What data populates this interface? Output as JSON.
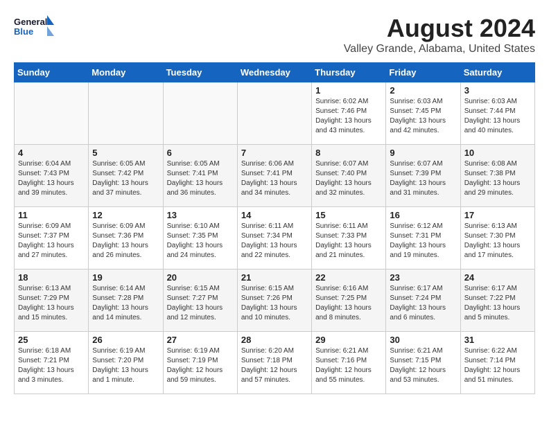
{
  "header": {
    "logo_line1": "General",
    "logo_line2": "Blue",
    "month_year": "August 2024",
    "location": "Valley Grande, Alabama, United States"
  },
  "weekdays": [
    "Sunday",
    "Monday",
    "Tuesday",
    "Wednesday",
    "Thursday",
    "Friday",
    "Saturday"
  ],
  "weeks": [
    [
      {
        "day": "",
        "info": ""
      },
      {
        "day": "",
        "info": ""
      },
      {
        "day": "",
        "info": ""
      },
      {
        "day": "",
        "info": ""
      },
      {
        "day": "1",
        "info": "Sunrise: 6:02 AM\nSunset: 7:46 PM\nDaylight: 13 hours\nand 43 minutes."
      },
      {
        "day": "2",
        "info": "Sunrise: 6:03 AM\nSunset: 7:45 PM\nDaylight: 13 hours\nand 42 minutes."
      },
      {
        "day": "3",
        "info": "Sunrise: 6:03 AM\nSunset: 7:44 PM\nDaylight: 13 hours\nand 40 minutes."
      }
    ],
    [
      {
        "day": "4",
        "info": "Sunrise: 6:04 AM\nSunset: 7:43 PM\nDaylight: 13 hours\nand 39 minutes."
      },
      {
        "day": "5",
        "info": "Sunrise: 6:05 AM\nSunset: 7:42 PM\nDaylight: 13 hours\nand 37 minutes."
      },
      {
        "day": "6",
        "info": "Sunrise: 6:05 AM\nSunset: 7:41 PM\nDaylight: 13 hours\nand 36 minutes."
      },
      {
        "day": "7",
        "info": "Sunrise: 6:06 AM\nSunset: 7:41 PM\nDaylight: 13 hours\nand 34 minutes."
      },
      {
        "day": "8",
        "info": "Sunrise: 6:07 AM\nSunset: 7:40 PM\nDaylight: 13 hours\nand 32 minutes."
      },
      {
        "day": "9",
        "info": "Sunrise: 6:07 AM\nSunset: 7:39 PM\nDaylight: 13 hours\nand 31 minutes."
      },
      {
        "day": "10",
        "info": "Sunrise: 6:08 AM\nSunset: 7:38 PM\nDaylight: 13 hours\nand 29 minutes."
      }
    ],
    [
      {
        "day": "11",
        "info": "Sunrise: 6:09 AM\nSunset: 7:37 PM\nDaylight: 13 hours\nand 27 minutes."
      },
      {
        "day": "12",
        "info": "Sunrise: 6:09 AM\nSunset: 7:36 PM\nDaylight: 13 hours\nand 26 minutes."
      },
      {
        "day": "13",
        "info": "Sunrise: 6:10 AM\nSunset: 7:35 PM\nDaylight: 13 hours\nand 24 minutes."
      },
      {
        "day": "14",
        "info": "Sunrise: 6:11 AM\nSunset: 7:34 PM\nDaylight: 13 hours\nand 22 minutes."
      },
      {
        "day": "15",
        "info": "Sunrise: 6:11 AM\nSunset: 7:33 PM\nDaylight: 13 hours\nand 21 minutes."
      },
      {
        "day": "16",
        "info": "Sunrise: 6:12 AM\nSunset: 7:31 PM\nDaylight: 13 hours\nand 19 minutes."
      },
      {
        "day": "17",
        "info": "Sunrise: 6:13 AM\nSunset: 7:30 PM\nDaylight: 13 hours\nand 17 minutes."
      }
    ],
    [
      {
        "day": "18",
        "info": "Sunrise: 6:13 AM\nSunset: 7:29 PM\nDaylight: 13 hours\nand 15 minutes."
      },
      {
        "day": "19",
        "info": "Sunrise: 6:14 AM\nSunset: 7:28 PM\nDaylight: 13 hours\nand 14 minutes."
      },
      {
        "day": "20",
        "info": "Sunrise: 6:15 AM\nSunset: 7:27 PM\nDaylight: 13 hours\nand 12 minutes."
      },
      {
        "day": "21",
        "info": "Sunrise: 6:15 AM\nSunset: 7:26 PM\nDaylight: 13 hours\nand 10 minutes."
      },
      {
        "day": "22",
        "info": "Sunrise: 6:16 AM\nSunset: 7:25 PM\nDaylight: 13 hours\nand 8 minutes."
      },
      {
        "day": "23",
        "info": "Sunrise: 6:17 AM\nSunset: 7:24 PM\nDaylight: 13 hours\nand 6 minutes."
      },
      {
        "day": "24",
        "info": "Sunrise: 6:17 AM\nSunset: 7:22 PM\nDaylight: 13 hours\nand 5 minutes."
      }
    ],
    [
      {
        "day": "25",
        "info": "Sunrise: 6:18 AM\nSunset: 7:21 PM\nDaylight: 13 hours\nand 3 minutes."
      },
      {
        "day": "26",
        "info": "Sunrise: 6:19 AM\nSunset: 7:20 PM\nDaylight: 13 hours\nand 1 minute."
      },
      {
        "day": "27",
        "info": "Sunrise: 6:19 AM\nSunset: 7:19 PM\nDaylight: 12 hours\nand 59 minutes."
      },
      {
        "day": "28",
        "info": "Sunrise: 6:20 AM\nSunset: 7:18 PM\nDaylight: 12 hours\nand 57 minutes."
      },
      {
        "day": "29",
        "info": "Sunrise: 6:21 AM\nSunset: 7:16 PM\nDaylight: 12 hours\nand 55 minutes."
      },
      {
        "day": "30",
        "info": "Sunrise: 6:21 AM\nSunset: 7:15 PM\nDaylight: 12 hours\nand 53 minutes."
      },
      {
        "day": "31",
        "info": "Sunrise: 6:22 AM\nSunset: 7:14 PM\nDaylight: 12 hours\nand 51 minutes."
      }
    ]
  ]
}
